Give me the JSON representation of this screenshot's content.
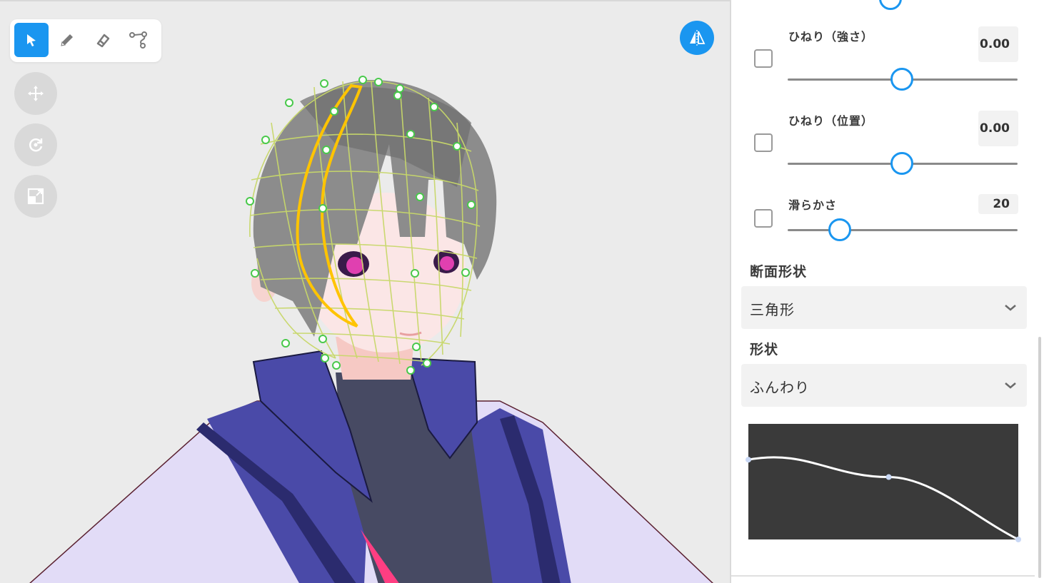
{
  "toolbar": {
    "tools": [
      {
        "name": "select-tool",
        "icon": "cursor-arrow-icon",
        "active": true
      },
      {
        "name": "pen-tool",
        "icon": "pencil-icon",
        "active": false
      },
      {
        "name": "eraser-tool",
        "icon": "eraser-icon",
        "active": false
      },
      {
        "name": "path-tool",
        "icon": "path-nodes-icon",
        "active": false
      }
    ],
    "view_controls": [
      "move-icon",
      "rotate-icon",
      "scale-icon"
    ],
    "mirror_button_icon": "mirror-symmetry-icon"
  },
  "colors": {
    "accent": "#1a96f0",
    "selected_stroke": "#ffc400",
    "mesh": "#c8d86a",
    "control_points": "#49c94b",
    "curve_background": "#3a3a3a"
  },
  "panel": {
    "params": [
      {
        "label": "ひねり（強さ）",
        "value": "0.00",
        "level": 0.5,
        "checked": false
      },
      {
        "label": "ひねり（位置）",
        "value": "0.00",
        "level": 0.5,
        "checked": false
      },
      {
        "label": "滑らかさ",
        "value": "20",
        "level": 0.23,
        "checked": false
      }
    ],
    "cross_section": {
      "title": "断面形状",
      "selected": "三角形"
    },
    "shape": {
      "title": "形状",
      "selected": "ふんわり"
    },
    "curve_points": [
      [
        0.0,
        0.69
      ],
      [
        0.52,
        0.54
      ],
      [
        1.0,
        0.0
      ]
    ]
  }
}
